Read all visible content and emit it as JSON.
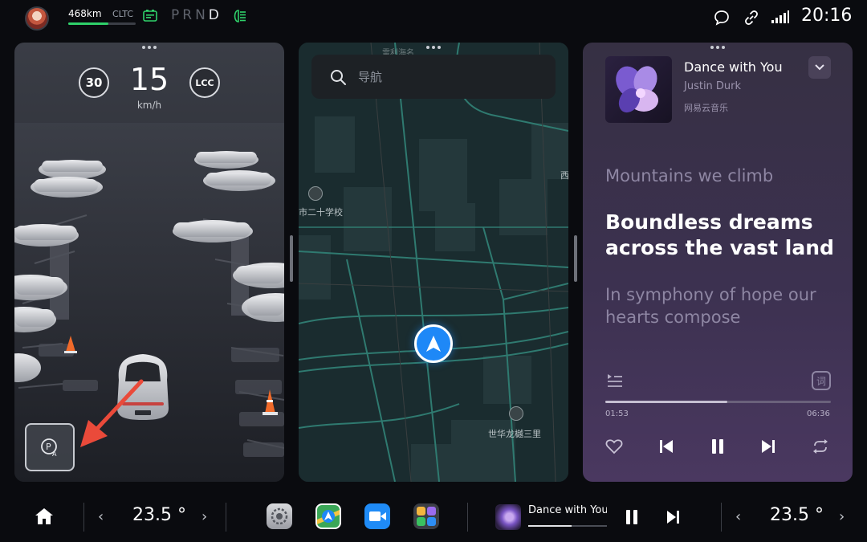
{
  "status_bar": {
    "range": "468km",
    "range_standard": "CLTC",
    "range_fraction": 0.6,
    "gear": {
      "letters": [
        "P",
        "R",
        "N",
        "D"
      ],
      "active": "D"
    },
    "time": "20:16",
    "icons": [
      "avatar",
      "battery-icon",
      "headlight-icon",
      "message-icon",
      "link-icon",
      "signal-icon"
    ]
  },
  "drive": {
    "speed_limit": "30",
    "speed": "15",
    "speed_unit": "km/h",
    "assist": "LCC",
    "park_icon": "auto-parking-icon"
  },
  "map": {
    "search_placeholder": "导航",
    "top_label": "雷利海名",
    "poi_school": "市二十学校",
    "poi_estate": "世华龙樾三里",
    "edge_label": "西",
    "colors": {
      "background": "#1a2c2f",
      "road": "#2f7a70",
      "block": "#24383b",
      "location": "#1e88f7"
    }
  },
  "music": {
    "title": "Dance with You",
    "artist": "Justin Durk",
    "source": "网易云音乐",
    "lyric_prev": "Mountains we climb",
    "lyric_current": "Boundless dreams across the vast land",
    "lyric_next": "In symphony of hope our hearts compose",
    "lyrics_toggle": "词",
    "elapsed": "01:53",
    "total": "06:36",
    "progress": 0.54,
    "controls": [
      "heart-icon",
      "previous-icon",
      "pause-icon",
      "next-icon",
      "repeat-icon"
    ]
  },
  "dock": {
    "temp_left": "23.5 °",
    "temp_right": "23.5 °",
    "apps": [
      "settings-app-icon",
      "navigation-app-icon",
      "video-call-app-icon",
      "app-grid-icon"
    ],
    "now_playing": "Dance with You",
    "now_playing_progress": 0.55
  }
}
